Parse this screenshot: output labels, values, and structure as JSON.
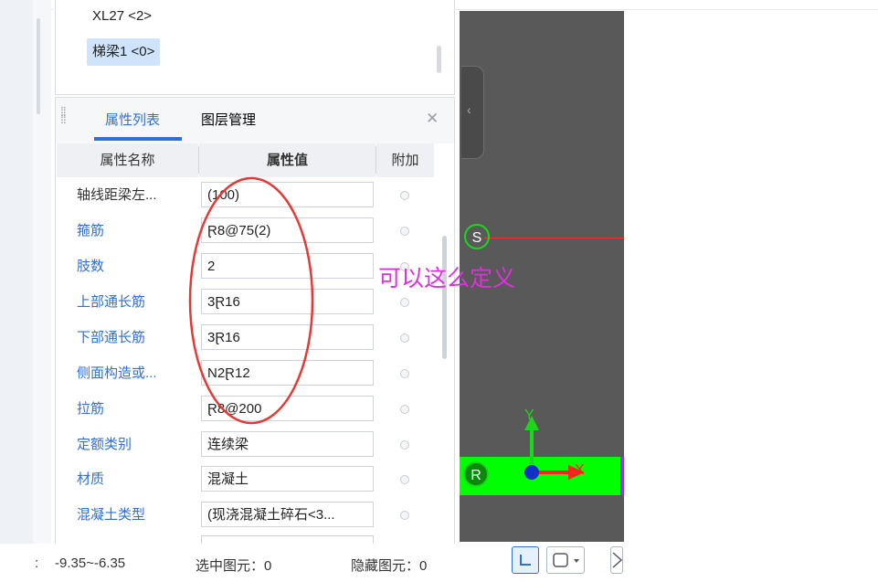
{
  "list": {
    "items": [
      {
        "label": "XL27 <2>",
        "selected": false
      },
      {
        "label": "梯梁1 <0>",
        "selected": true
      }
    ]
  },
  "tabs": [
    {
      "label": "属性列表",
      "active": true
    },
    {
      "label": "图层管理",
      "active": false
    }
  ],
  "table": {
    "headers": {
      "name": "属性名称",
      "value": "属性值",
      "extra": "附加"
    },
    "rows": [
      {
        "name": "轴线距梁左...",
        "value": "(100)",
        "name_color": "black"
      },
      {
        "name": "箍筋",
        "value": "Ɽ8@75(2)",
        "name_color": "blue"
      },
      {
        "name": "肢数",
        "value": "2",
        "name_color": "blue"
      },
      {
        "name": "上部通长筋",
        "value": "3Ɽ16",
        "name_color": "blue"
      },
      {
        "name": "下部通长筋",
        "value": "3Ɽ16",
        "name_color": "blue"
      },
      {
        "name": "侧面构造或...",
        "value": "N2Ɽ12",
        "name_color": "blue"
      },
      {
        "name": "拉筋",
        "value": "Ɽ8@200",
        "name_color": "blue"
      },
      {
        "name": "定额类别",
        "value": "连续梁",
        "name_color": "blue"
      },
      {
        "name": "材质",
        "value": "混凝土",
        "name_color": "blue"
      },
      {
        "name": "混凝土类型",
        "value": "(现浇混凝土碎石<3...",
        "name_color": "blue"
      }
    ]
  },
  "annotation": {
    "text": "可以这么定义",
    "color": "#e02fe0"
  },
  "viewport": {
    "axis_s": "S",
    "axis_r": "R",
    "axis_x": "X",
    "axis_y": "Y"
  },
  "status": {
    "coords": "-9.35~-6.35",
    "coords_prefix": ":",
    "selected_label": "选中图元：0",
    "hidden_label": "隐藏图元：0"
  },
  "colors": {
    "accent": "#2f6fd6",
    "highlight_circle": "#e53935",
    "green_element": "#00ff00",
    "viewport_bg": "#595959"
  },
  "icons": {
    "close": "close-icon",
    "drag": "drag-handle-icon",
    "collapse": "chevron-left-icon"
  }
}
